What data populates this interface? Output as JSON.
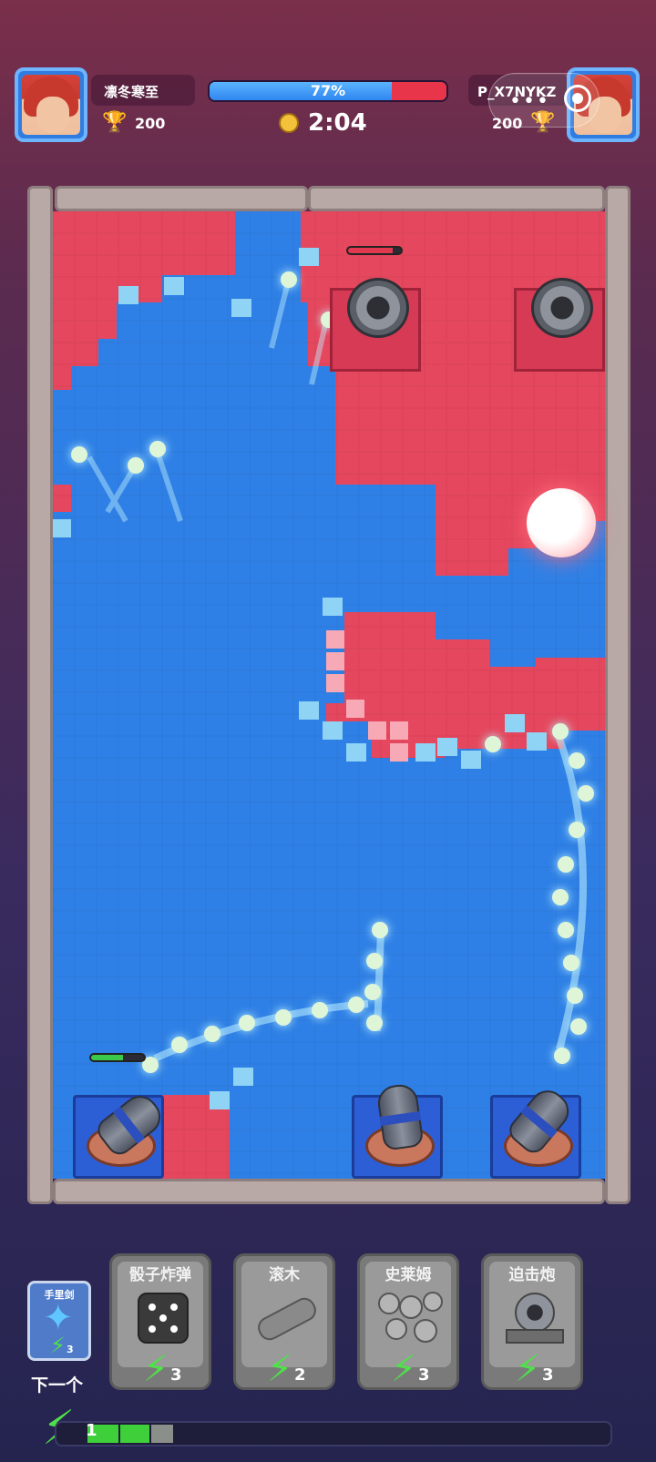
{
  "hud": {
    "player_left": {
      "name": "凛冬寒至",
      "trophies": "200"
    },
    "player_right": {
      "name": "P_X7NYKZ",
      "trophies": "200"
    },
    "progress": {
      "text": "77%",
      "value": 0.77
    },
    "timer": "2:04"
  },
  "board": {
    "player_color": "#2f80e6",
    "enemy_color": "#e5475e",
    "enemy_towers": [
      "mortar-left",
      "mortar-right"
    ],
    "player_towers": [
      "cannon-left",
      "cannon-center",
      "cannon-right"
    ],
    "left_cannon_health": 0.6,
    "enemy_left_health": 0.85
  },
  "cards": {
    "next": {
      "label": "手里剑",
      "cost": "3",
      "caption": "下一个"
    },
    "hand": [
      {
        "name": "骰子炸弹",
        "cost": "3",
        "icon": "dice-icon"
      },
      {
        "name": "滚木",
        "cost": "2",
        "icon": "log-icon"
      },
      {
        "name": "史莱姆",
        "cost": "3",
        "icon": "slime-icon"
      },
      {
        "name": "迫击炮",
        "cost": "3",
        "icon": "mortar-icon"
      }
    ]
  },
  "elixir": {
    "value": "1",
    "fill": 0.18
  }
}
